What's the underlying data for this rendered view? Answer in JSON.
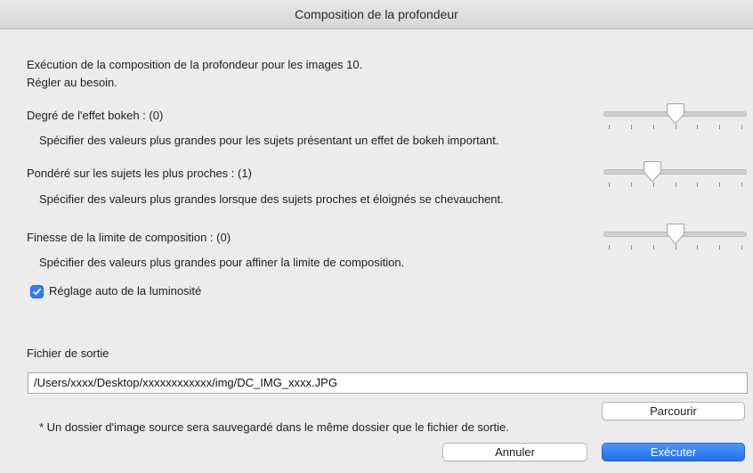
{
  "window": {
    "title": "Composition de la profondeur"
  },
  "intro": {
    "line1": "Exécution de la composition de la profondeur pour les images 10.",
    "line2": "Régler au besoin."
  },
  "settings": [
    {
      "label": "Degré de l'effet bokeh : (0)",
      "description": "Spécifier des valeurs plus grandes pour les sujets présentant un effet de bokeh important.",
      "slider_position": 0.5
    },
    {
      "label": "Pondéré sur les sujets les plus proches : (1)",
      "description": "Spécifier des valeurs plus grandes lorsque des sujets proches et éloignés se chevauchent.",
      "slider_position": 0.33
    },
    {
      "label": "Finesse de la limite de composition : (0)",
      "description": "Spécifier des valeurs plus grandes pour affiner la limite de composition.",
      "slider_position": 0.5
    }
  ],
  "auto_brightness": {
    "label": "Réglage auto de la luminosité",
    "checked": true
  },
  "output": {
    "label": "Fichier de sortie",
    "path": "/Users/xxxx/Desktop/xxxxxxxxxxxx/img/DC_IMG_xxxx.JPG",
    "browse_label": "Parcourir",
    "note": "* Un dossier d'image source sera sauvegardé dans le même dossier que le fichier de sortie."
  },
  "buttons": {
    "cancel": "Annuler",
    "execute": "Exécuter"
  },
  "colors": {
    "accent": "#2f7bf6",
    "window_bg": "#ececec"
  },
  "icons": {
    "checkbox": "checkmark-icon",
    "slider_thumb": "slider-thumb-icon"
  }
}
